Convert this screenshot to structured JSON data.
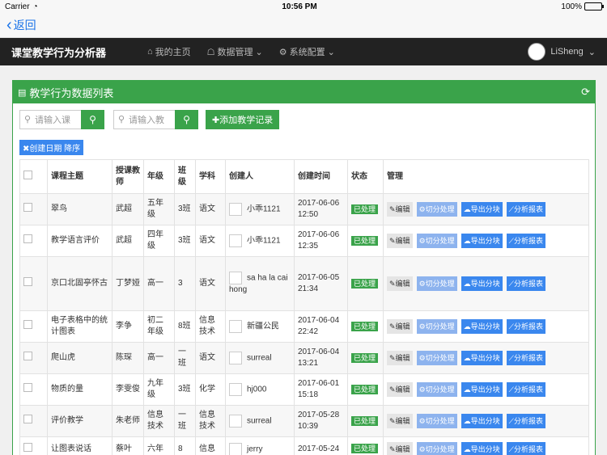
{
  "status": {
    "carrier": "Carrier",
    "time": "10:56 PM",
    "battery": "100%"
  },
  "nav": {
    "back": "返回"
  },
  "app": {
    "brand": "课堂教学行为分析器",
    "menu": [
      "我的主页",
      "数据管理",
      "系统配置"
    ],
    "user": "LiSheng"
  },
  "panel": {
    "title": "教学行为数据列表",
    "search1_placeholder": "请输入课",
    "search2_placeholder": "请输入教",
    "add_label": "添加教学记录",
    "sort_tag": "创建日期 降序"
  },
  "table": {
    "headers": [
      "课程主题",
      "授课教师",
      "年级",
      "班级",
      "学科",
      "创建人",
      "创建时间",
      "状态",
      "管理"
    ],
    "actions": [
      "编辑",
      "切分处理",
      "导出分块",
      "分析报表"
    ],
    "rows": [
      {
        "topic": "翠鸟",
        "teacher": "武超",
        "grade": "五年级",
        "class": "3班",
        "subject": "语文",
        "creator": "小乖1121",
        "time": "2017-06-06 12:50",
        "state": "已处理"
      },
      {
        "topic": "教学语言评价",
        "teacher": "武超",
        "grade": "四年级",
        "class": "3班",
        "subject": "语文",
        "creator": "小乖1121",
        "time": "2017-06-06 12:35",
        "state": "已处理"
      },
      {
        "topic": "京口北固亭怀古",
        "teacher": "丁梦娅",
        "grade": "高一",
        "class": "3",
        "subject": "语文",
        "creator": "sa ha la cai hong",
        "time": "2017-06-05 21:34",
        "state": "已处理"
      },
      {
        "topic": "电子表格中的统计图表",
        "teacher": "李争",
        "grade": "初二年级",
        "class": "8班",
        "subject": "信息技术",
        "creator": "新疆公民",
        "time": "2017-06-04 22:42",
        "state": "已处理"
      },
      {
        "topic": "爬山虎",
        "teacher": "陈琛",
        "grade": "高一",
        "class": "一班",
        "subject": "语文",
        "creator": "surreal",
        "time": "2017-06-04 13:21",
        "state": "已处理"
      },
      {
        "topic": "物质的量",
        "teacher": "李雯俊",
        "grade": "九年级",
        "class": "3班",
        "subject": "化学",
        "creator": "hj000",
        "time": "2017-06-01 15:18",
        "state": "已处理"
      },
      {
        "topic": "评价教学",
        "teacher": "朱老师",
        "grade": "信息技术",
        "class": "一班",
        "subject": "信息技术",
        "creator": "surreal",
        "time": "2017-05-28 10:39",
        "state": "已处理"
      },
      {
        "topic": "让图表说话",
        "teacher": "蔡叶",
        "grade": "六年",
        "class": "8",
        "subject": "信息",
        "creator": "jerry",
        "time": "2017-05-24",
        "state": "已处理"
      }
    ]
  }
}
